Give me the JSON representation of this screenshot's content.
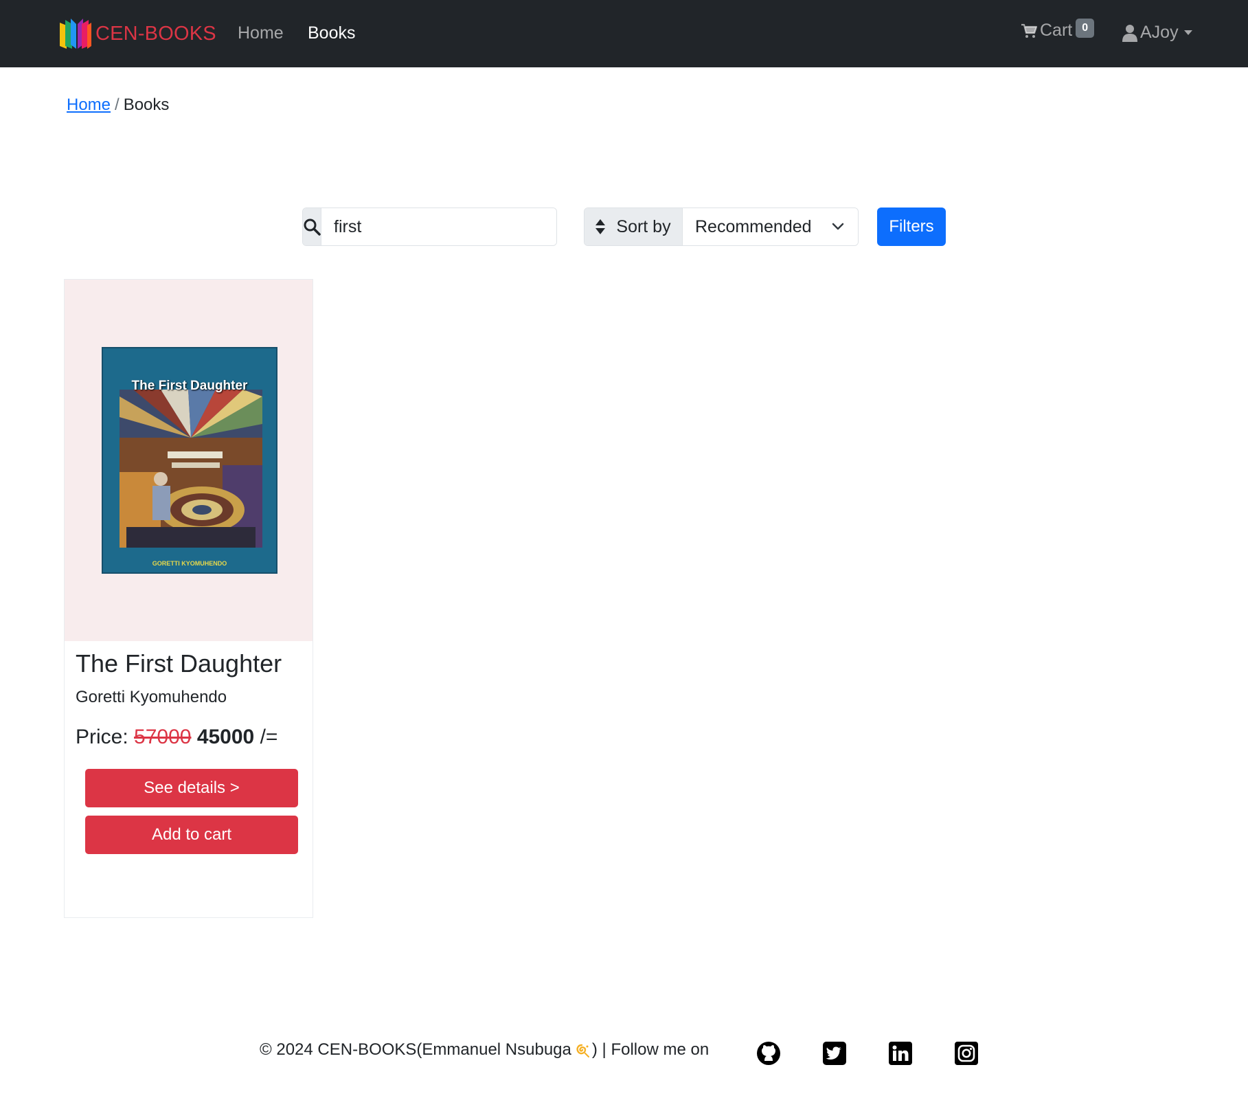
{
  "navbar": {
    "brand": "CEN-BOOKS",
    "links": [
      {
        "label": "Home",
        "active": false
      },
      {
        "label": "Books",
        "active": true
      }
    ],
    "cart_label": "Cart",
    "cart_count": "0",
    "user_name": "AJoy"
  },
  "breadcrumb": {
    "home": "Home",
    "separator": "/",
    "current": "Books"
  },
  "toolbar": {
    "search_value": "first",
    "sort_label": "Sort by",
    "sort_value": "Recommended",
    "filters_label": "Filters"
  },
  "books": [
    {
      "cover_title": "The First Daughter",
      "cover_author": "GORETTI KYOMUHENDO",
      "title": "The First Daughter",
      "author": "Goretti Kyomuhendo",
      "price_label": "Price:",
      "old_price": "57000",
      "new_price": "45000",
      "currency_suffix": "/=",
      "details_label": "See details >",
      "cart_label": "Add to cart"
    }
  ],
  "footer": {
    "copyright": "© 2024 CEN-BOOKS(Emmanuel Nsubuga",
    "follow": ") | Follow me on",
    "social": [
      "github-icon",
      "twitter-icon",
      "linkedin-icon",
      "instagram-icon"
    ]
  },
  "colors": {
    "navbar_bg": "#212529",
    "brand": "#dc3545",
    "primary": "#0d6efd",
    "danger": "#dc3545",
    "card_image_bg": "#f8eced"
  }
}
